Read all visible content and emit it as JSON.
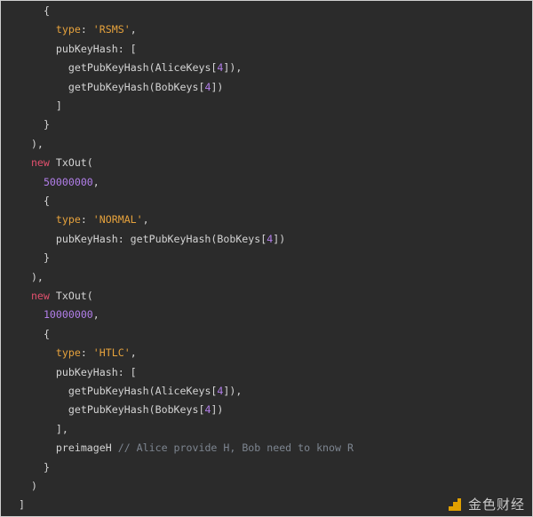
{
  "code_lines": [
    {
      "indent": 6,
      "parts": [
        [
          "pl",
          "{"
        ]
      ]
    },
    {
      "indent": 8,
      "parts": [
        [
          "key",
          "type"
        ],
        [
          "pl",
          ": "
        ],
        [
          "str",
          "'RSMS'"
        ],
        [
          "pl",
          ","
        ]
      ]
    },
    {
      "indent": 8,
      "parts": [
        [
          "pl",
          "pubKeyHash: ["
        ]
      ]
    },
    {
      "indent": 10,
      "parts": [
        [
          "pl",
          "getPubKeyHash(AliceKeys["
        ],
        [
          "num",
          "4"
        ],
        [
          "pl",
          "]),"
        ]
      ]
    },
    {
      "indent": 10,
      "parts": [
        [
          "pl",
          "getPubKeyHash(BobKeys["
        ],
        [
          "num",
          "4"
        ],
        [
          "pl",
          "])"
        ]
      ]
    },
    {
      "indent": 8,
      "parts": [
        [
          "pl",
          "]"
        ]
      ]
    },
    {
      "indent": 6,
      "parts": [
        [
          "pl",
          "}"
        ]
      ]
    },
    {
      "indent": 4,
      "parts": [
        [
          "pl",
          "),"
        ]
      ]
    },
    {
      "indent": 4,
      "parts": [
        [
          "kw",
          "new"
        ],
        [
          "pl",
          " TxOut("
        ]
      ]
    },
    {
      "indent": 6,
      "parts": [
        [
          "num",
          "50000000"
        ],
        [
          "pl",
          ","
        ]
      ]
    },
    {
      "indent": 6,
      "parts": [
        [
          "pl",
          "{"
        ]
      ]
    },
    {
      "indent": 8,
      "parts": [
        [
          "key",
          "type"
        ],
        [
          "pl",
          ": "
        ],
        [
          "str",
          "'NORMAL'"
        ],
        [
          "pl",
          ","
        ]
      ]
    },
    {
      "indent": 8,
      "parts": [
        [
          "pl",
          "pubKeyHash: getPubKeyHash(BobKeys["
        ],
        [
          "num",
          "4"
        ],
        [
          "pl",
          "])"
        ]
      ]
    },
    {
      "indent": 6,
      "parts": [
        [
          "pl",
          "}"
        ]
      ]
    },
    {
      "indent": 4,
      "parts": [
        [
          "pl",
          "),"
        ]
      ]
    },
    {
      "indent": 4,
      "parts": [
        [
          "kw",
          "new"
        ],
        [
          "pl",
          " TxOut("
        ]
      ]
    },
    {
      "indent": 6,
      "parts": [
        [
          "num",
          "10000000"
        ],
        [
          "pl",
          ","
        ]
      ]
    },
    {
      "indent": 6,
      "parts": [
        [
          "pl",
          "{"
        ]
      ]
    },
    {
      "indent": 8,
      "parts": [
        [
          "key",
          "type"
        ],
        [
          "pl",
          ": "
        ],
        [
          "str",
          "'HTLC'"
        ],
        [
          "pl",
          ","
        ]
      ]
    },
    {
      "indent": 8,
      "parts": [
        [
          "pl",
          "pubKeyHash: ["
        ]
      ]
    },
    {
      "indent": 10,
      "parts": [
        [
          "pl",
          "getPubKeyHash(AliceKeys["
        ],
        [
          "num",
          "4"
        ],
        [
          "pl",
          "]),"
        ]
      ]
    },
    {
      "indent": 10,
      "parts": [
        [
          "pl",
          "getPubKeyHash(BobKeys["
        ],
        [
          "num",
          "4"
        ],
        [
          "pl",
          "])"
        ]
      ]
    },
    {
      "indent": 8,
      "parts": [
        [
          "pl",
          "],"
        ]
      ]
    },
    {
      "indent": 8,
      "parts": [
        [
          "pl",
          "preimageH "
        ],
        [
          "cm",
          "// Alice provide H, Bob need to know R"
        ]
      ]
    },
    {
      "indent": 6,
      "parts": [
        [
          "pl",
          "}"
        ]
      ]
    },
    {
      "indent": 4,
      "parts": [
        [
          "pl",
          ")"
        ]
      ]
    },
    {
      "indent": 2,
      "parts": [
        [
          "pl",
          "]"
        ]
      ]
    }
  ],
  "colors": {
    "background": "#2b2b2b",
    "keyword": "#e0506d",
    "string": "#e6a23c",
    "number": "#b37feb",
    "comment": "#7d8590",
    "plain": "#d4d4d4"
  },
  "watermark": {
    "text": "金色财经",
    "icon": "jinse-logo-icon"
  }
}
